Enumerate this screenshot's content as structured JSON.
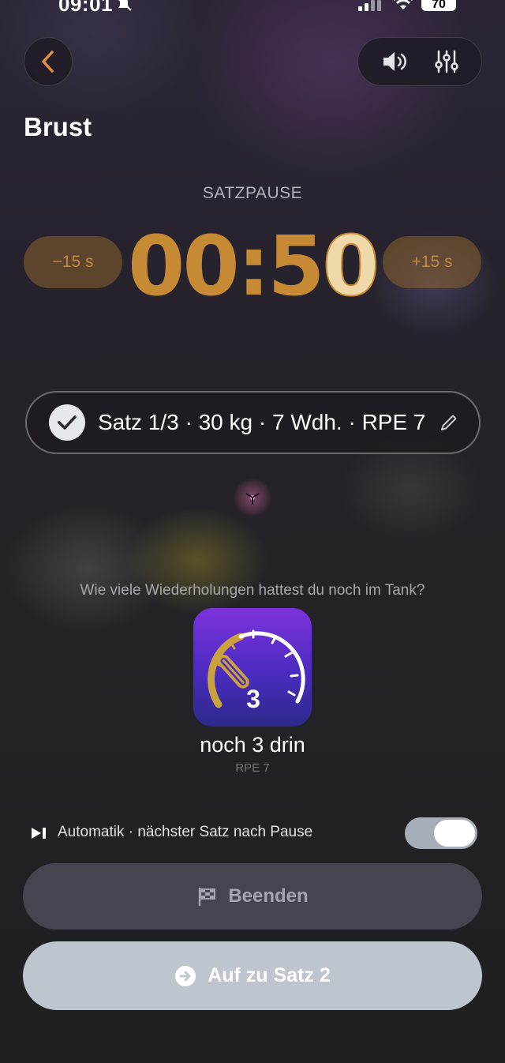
{
  "status_bar": {
    "time": "09:01",
    "battery": "70"
  },
  "header": {
    "title": "Brust"
  },
  "timer": {
    "label": "SATZPAUSE",
    "value_main": "00:5",
    "value_last": "0",
    "minus_label": "−15 s",
    "plus_label": "+15 s"
  },
  "set_summary": {
    "text": "Satz 1/3 · 30 kg · 7 Wdh. · RPE 7"
  },
  "rir": {
    "question": "Wie viele Wiederholungen hattest du noch im Tank?",
    "gauge_number": "3",
    "title": "noch 3 drin",
    "subtitle": "RPE 7"
  },
  "auto": {
    "label": "Automatik · nächster Satz nach Pause",
    "enabled": true
  },
  "buttons": {
    "end_label": "Beenden",
    "next_label": "Auf zu Satz 2"
  },
  "colors": {
    "accent": "#c78a34",
    "gauge_top": "#7c33dc",
    "gauge_bottom": "#2d2a8a"
  }
}
